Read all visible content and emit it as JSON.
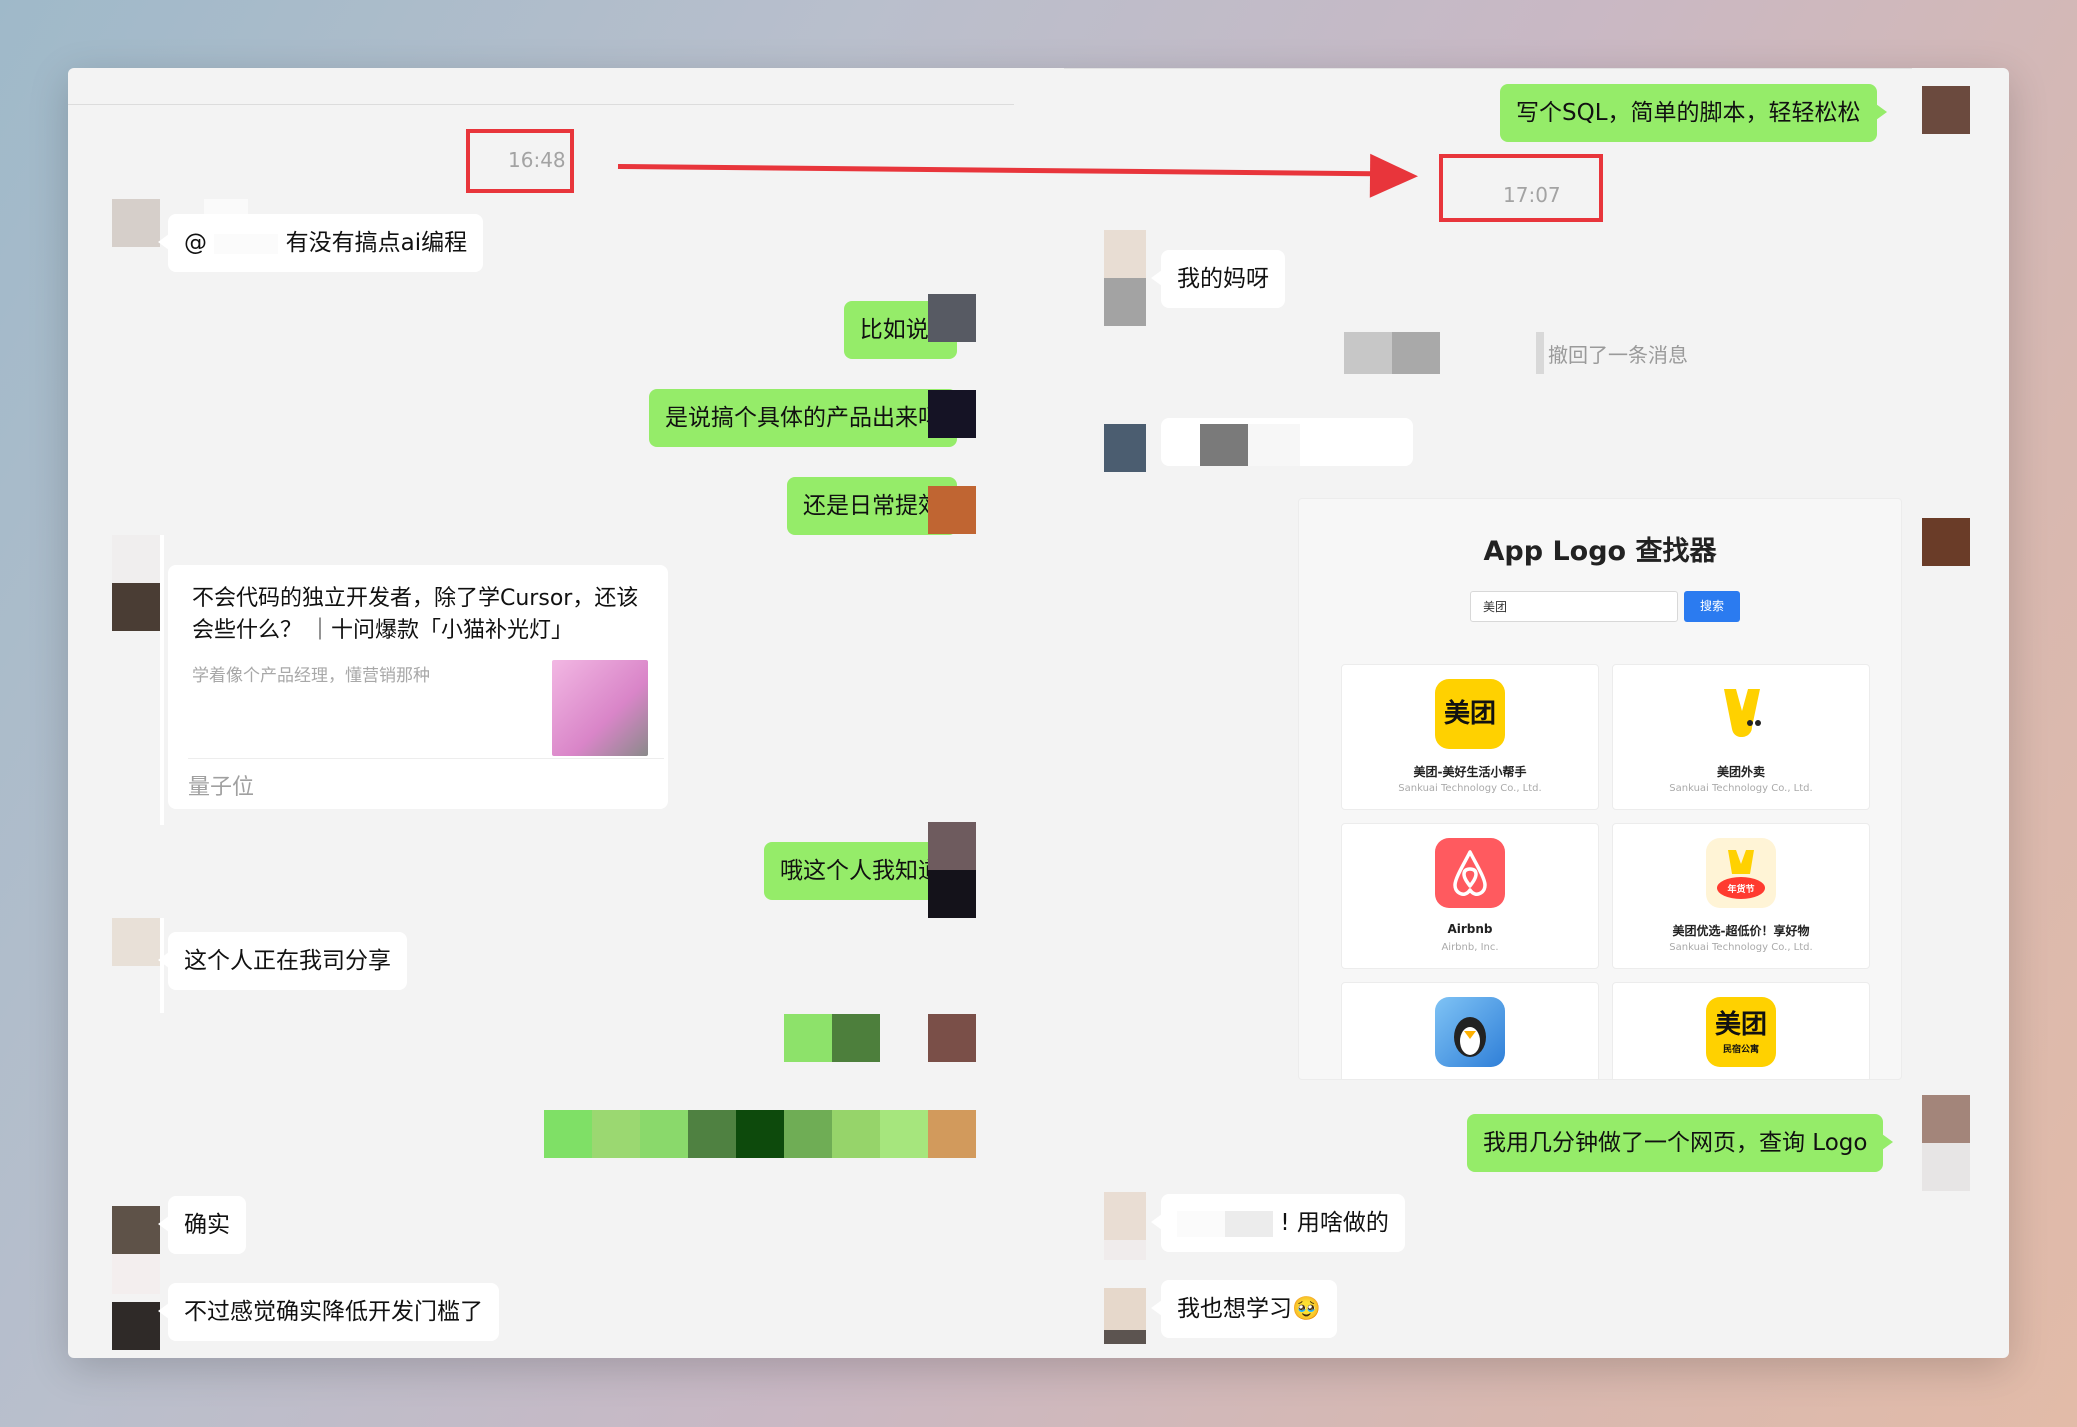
{
  "left_panel": {
    "time_stamp": "16:48",
    "messages": {
      "m1_prefix": "@",
      "m1_text": "有没有搞点ai编程",
      "m2_text": "比如说?",
      "m3_text": "是说搞个具体的产品出来吗",
      "m4_text": "还是日常提效",
      "m5_text": "哦这个人我知道",
      "m6_text": "这个人正在我司分享",
      "m7_text": "确实",
      "m8_text": "不过感觉确实降低开发门槛了"
    },
    "link_card": {
      "title": "不会代码的独立开发者，除了学Cursor，还该会些什么？ ｜十问爆款「小猫补光灯」",
      "desc": "学着像个产品经理，懂营销那种",
      "source": "量子位"
    }
  },
  "right_panel": {
    "time_stamp": "17:07",
    "messages": {
      "r0_text": "写个SQL，简单的脚本，轻轻松松",
      "r1_text": "我的妈呀",
      "recall_text": "撤回了一条消息",
      "r2_text": "我用几分钟做了一个网页，查询 Logo",
      "r3_text": "用啥做的",
      "r3_prefix": "!",
      "r4_text": "我也想学习",
      "r4_emoji": "🥹"
    },
    "screenshot": {
      "title": "App Logo 查找器",
      "search_value": "美团",
      "search_button": "搜索",
      "tiles": [
        {
          "name": "美团-美好生活小帮手",
          "company": "Sankuai Technology Co., Ltd.",
          "logo_text": "美团",
          "logo_color": "#ffd100"
        },
        {
          "name": "美团外卖",
          "company": "Sankuai Technology Co., Ltd.",
          "logo_text": "",
          "logo_color": "#ffd100"
        },
        {
          "name": "Airbnb",
          "company": "Airbnb, Inc.",
          "logo_text": "",
          "logo_color": "#ff5a5f"
        },
        {
          "name": "美团优选-超低价！享好物",
          "company": "Sankuai Technology Co., Ltd.",
          "logo_text": "年货节",
          "logo_color": "#ff3b30"
        },
        {
          "name": "",
          "company": "",
          "logo_text": "",
          "logo_color": "#2f7fd8"
        },
        {
          "name": "",
          "company": "",
          "logo_text": "美团",
          "sub_text": "民宿公寓",
          "logo_color": "#ffd100"
        }
      ]
    }
  },
  "annotation": {
    "color": "#e8353b"
  },
  "colors": {
    "bubble_green": "#95ec69",
    "bubble_white": "#ffffff",
    "window_bg": "#f3f3f3"
  }
}
